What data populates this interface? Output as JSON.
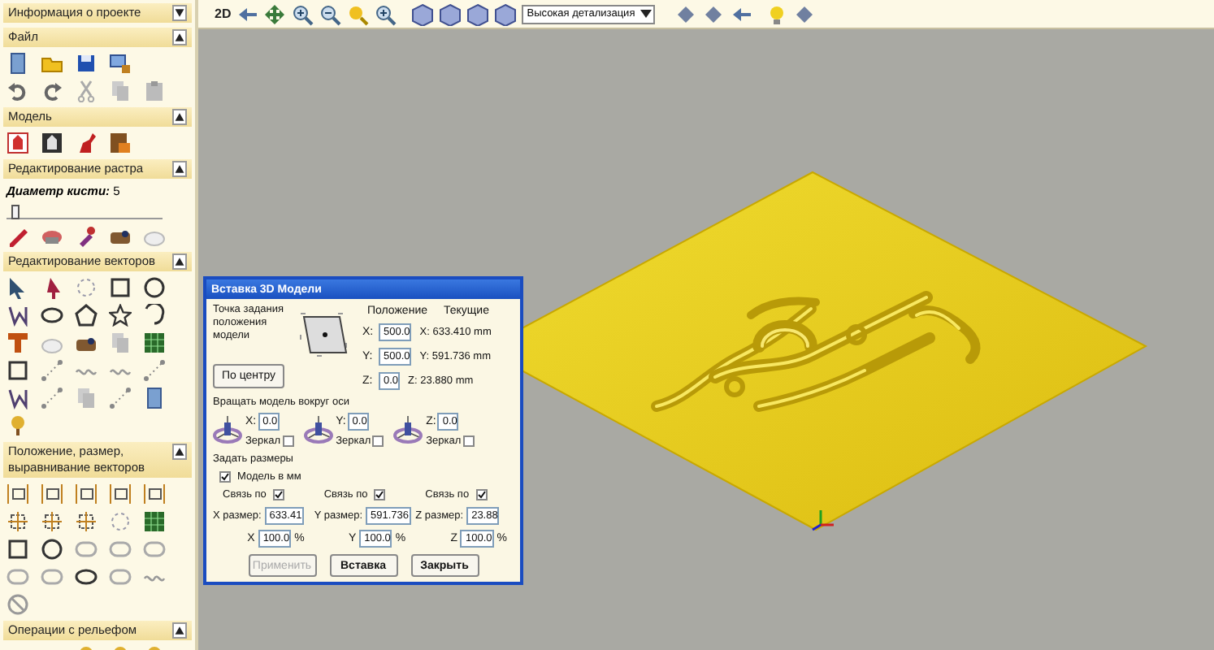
{
  "panel_sections": [
    {
      "title": "Информация о проекте",
      "expanded": false
    },
    {
      "title": "Файл",
      "expanded": true
    },
    {
      "title": "Модель",
      "expanded": true
    },
    {
      "title": "Редактирование растра",
      "expanded": true,
      "brush": {
        "label": "Диаметр кисти:",
        "value": "5",
        "level": 0.03
      }
    },
    {
      "title": "Редактирование векторов",
      "expanded": true
    },
    {
      "title": "Положение, размер, выравнивание векторов",
      "expanded": true
    },
    {
      "title": "Операции с рельефом",
      "expanded": true
    }
  ],
  "toolbar": {
    "view_mode": "2D",
    "detail": "Высокая детализация"
  },
  "dialog": {
    "title": "Вставка 3D Модели",
    "anchor_label": "Точка задания положения модели",
    "center_button": "По центру",
    "position_header": "Положение",
    "current_header": "Текущие",
    "positions": [
      {
        "axis": "X:",
        "value": "500.0",
        "current": "X: 633.410 mm"
      },
      {
        "axis": "Y:",
        "value": "500.0",
        "current": "Y: 591.736 mm"
      },
      {
        "axis": "Z:",
        "value": "0.0",
        "current": "Z: 23.880 mm"
      }
    ],
    "rotate_label": "Вращать модель вокруг оси",
    "rotations": [
      {
        "axis": "X:",
        "value": "0.0",
        "mirror_label": "Зеркал",
        "mirror": false
      },
      {
        "axis": "Y:",
        "value": "0.0",
        "mirror_label": "Зеркал",
        "mirror": false
      },
      {
        "axis": "Z:",
        "value": "0.0",
        "mirror_label": "Зеркал",
        "mirror": false
      }
    ],
    "sizes_label": "Задать размеры",
    "model_in_mm": {
      "label": "Модель в мм",
      "checked": true
    },
    "sizes": [
      {
        "link_label": "Связь по",
        "linked": true,
        "label": "X размер:",
        "value": "633.41",
        "percent_label": "X",
        "percent": "100.0",
        "unit": "%"
      },
      {
        "link_label": "Связь по",
        "linked": true,
        "label": "Y размер:",
        "value": "591.736",
        "percent_label": "Y",
        "percent": "100.0",
        "unit": "%"
      },
      {
        "link_label": "Связь по",
        "linked": true,
        "label": "Z размер:",
        "value": "23.88",
        "percent_label": "Z",
        "percent": "100.0",
        "unit": "%"
      }
    ],
    "buttons": [
      {
        "label": "Применить",
        "disabled": true
      },
      {
        "label": "Вставка",
        "disabled": false
      },
      {
        "label": "Закрыть",
        "disabled": false
      }
    ]
  }
}
